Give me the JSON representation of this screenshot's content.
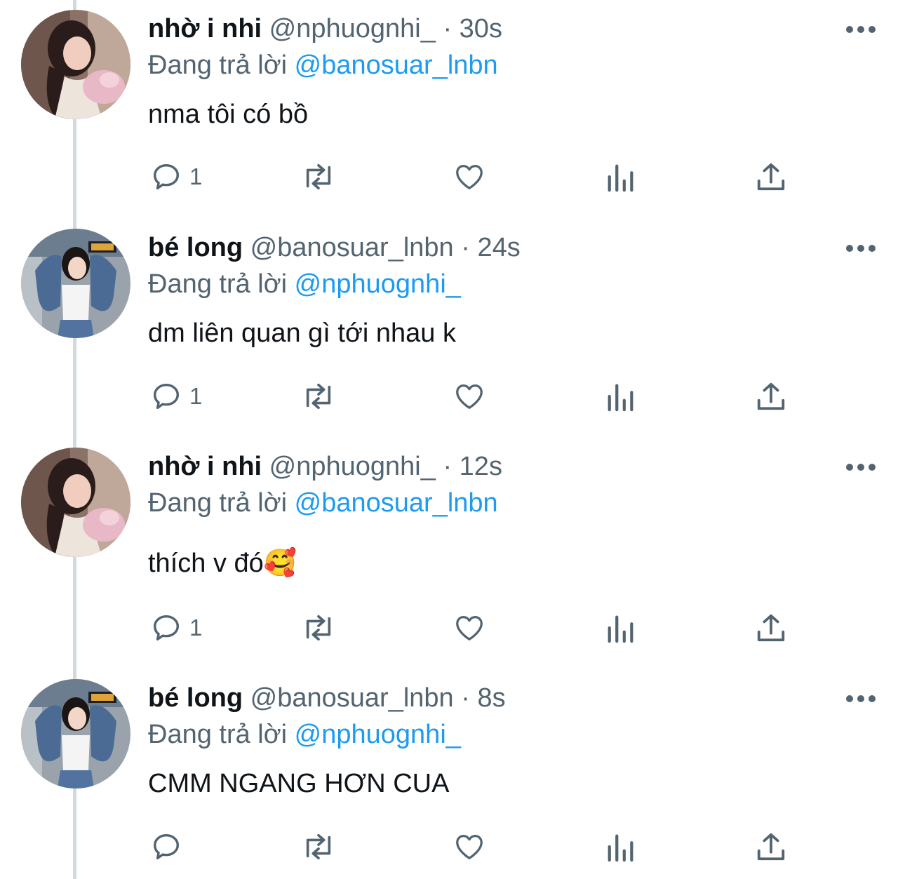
{
  "thread": {
    "tweets": [
      {
        "display_name": "nhờ i nhi",
        "handle": "@nphuognhi_",
        "separator": "·",
        "time": "30s",
        "replying_prefix": "Đang trả lời",
        "replying_to": "@banosuar_lnbn",
        "text": "nma tôi có bồ",
        "reply_count": "1",
        "avatar": "avatar-nhi"
      },
      {
        "display_name": "bé long",
        "handle": "@banosuar_lnbn",
        "separator": "·",
        "time": "24s",
        "replying_prefix": "Đang trả lời",
        "replying_to": "@nphuognhi_",
        "text": "dm liên quan gì tới nhau k",
        "reply_count": "1",
        "avatar": "avatar-long"
      },
      {
        "display_name": "nhờ i nhi",
        "handle": "@nphuognhi_",
        "separator": "·",
        "time": "12s",
        "replying_prefix": "Đang trả lời",
        "replying_to": "@banosuar_lnbn",
        "text": "thích v đó🥰",
        "reply_count": "1",
        "avatar": "avatar-nhi"
      },
      {
        "display_name": "bé long",
        "handle": "@banosuar_lnbn",
        "separator": "·",
        "time": "8s",
        "replying_prefix": "Đang trả lời",
        "replying_to": "@nphuognhi_",
        "text": "CMM NGANG HƠN CUA",
        "reply_count": "",
        "avatar": "avatar-long"
      }
    ]
  },
  "icons": {
    "reply": "speech-bubble-icon",
    "retweet": "retweet-icon",
    "like": "heart-icon",
    "views": "bar-chart-icon",
    "share": "share-upload-icon",
    "more": "more-dots-icon"
  },
  "colors": {
    "text": "#0f1419",
    "secondary": "#536471",
    "mention": "#1d9bf0",
    "thread_line": "#cfd9de"
  }
}
